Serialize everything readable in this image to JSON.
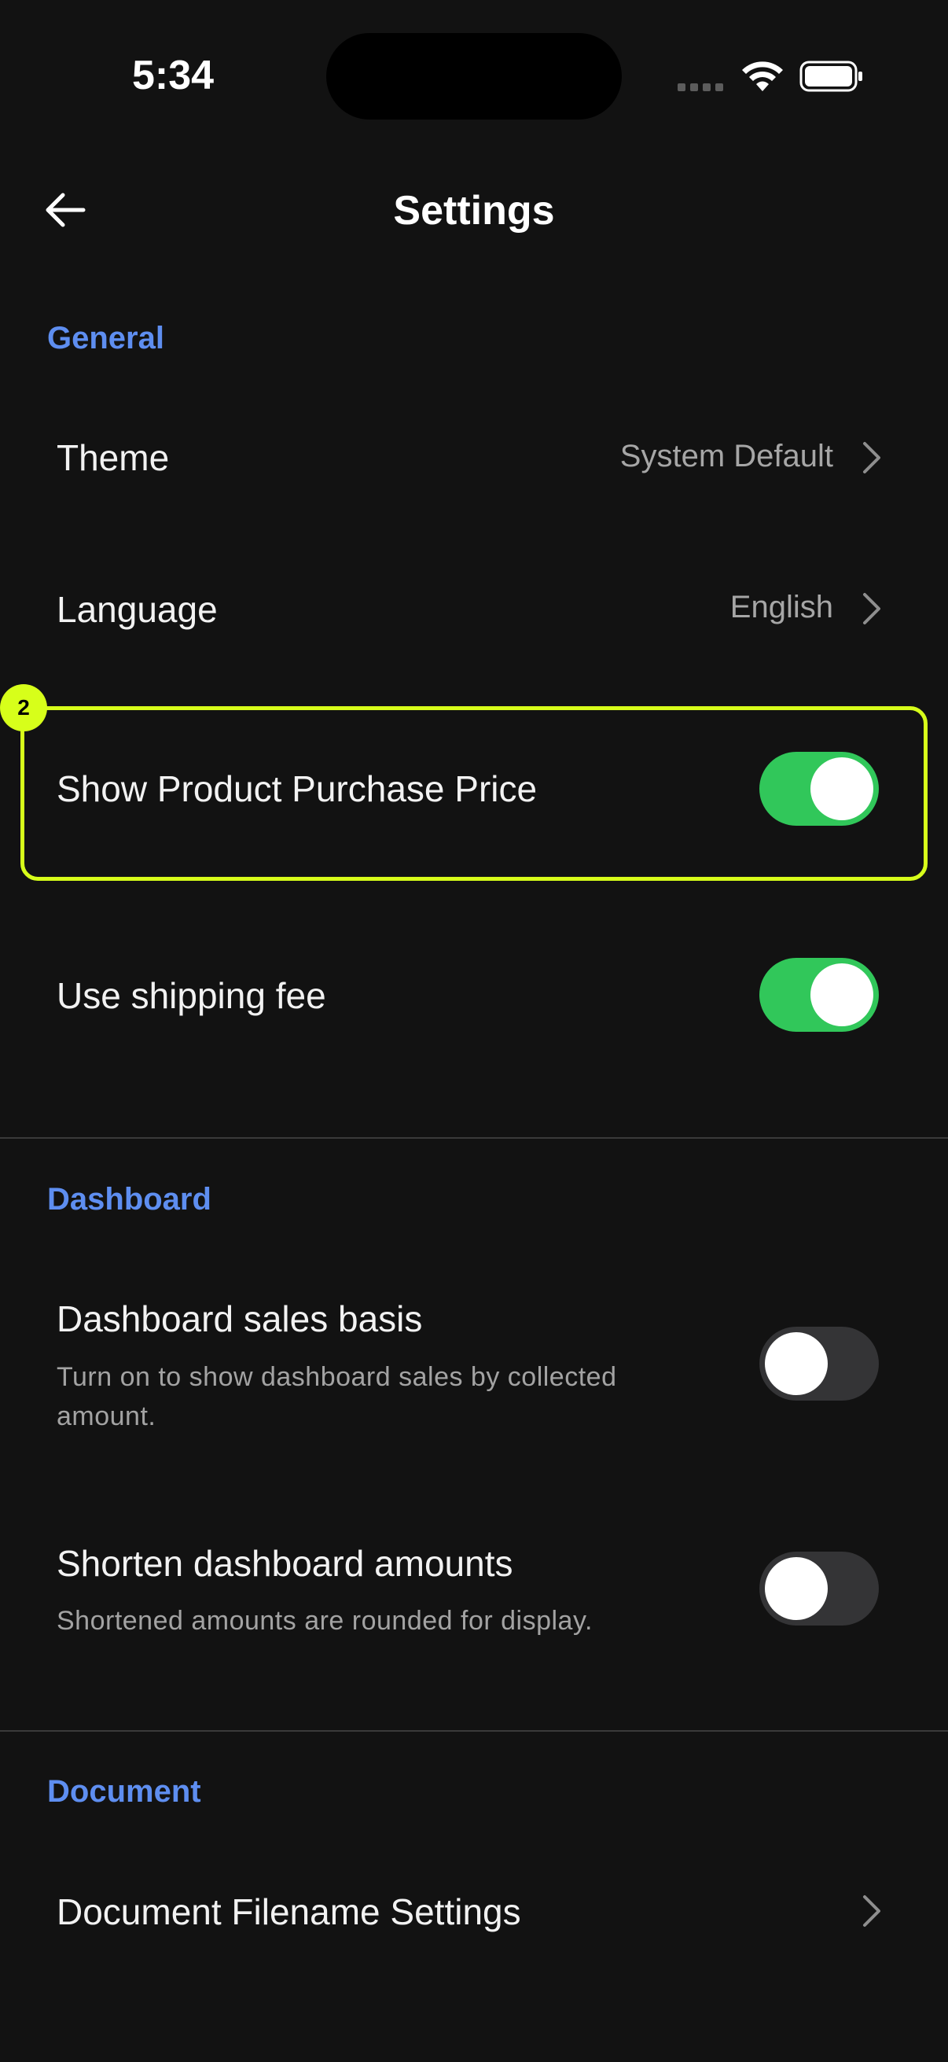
{
  "status_bar": {
    "time": "5:34"
  },
  "header": {
    "title": "Settings"
  },
  "sections": {
    "general": {
      "label": "General",
      "theme": {
        "label": "Theme",
        "value": "System Default"
      },
      "language": {
        "label": "Language",
        "value": "English"
      },
      "show_purchase_price": {
        "label": "Show Product Purchase Price",
        "enabled": true
      },
      "shipping_fee": {
        "label": "Use shipping fee",
        "enabled": true
      }
    },
    "dashboard": {
      "label": "Dashboard",
      "sales_basis": {
        "label": "Dashboard sales basis",
        "description": "Turn on to show dashboard sales by collected amount.",
        "enabled": false
      },
      "shorten_amounts": {
        "label": "Shorten dashboard amounts",
        "description": "Shortened amounts are rounded for display.",
        "enabled": false
      }
    },
    "document": {
      "label": "Document",
      "filename_settings": {
        "label": "Document Filename Settings"
      }
    }
  },
  "annotation": {
    "badge": "2"
  },
  "colors": {
    "accent": "#5e8ef0",
    "toggle_on": "#31c75a",
    "highlight": "#d7ff1a",
    "background": "#121212"
  }
}
